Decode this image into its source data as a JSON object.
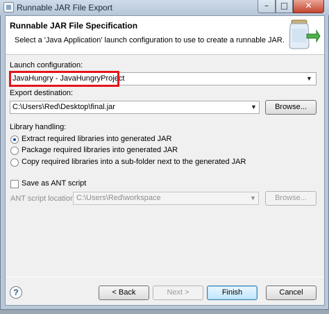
{
  "window": {
    "title": "Runnable JAR File Export",
    "minimize_glyph": "–",
    "maximize_glyph": "□",
    "close_glyph": "✕"
  },
  "header": {
    "title": "Runnable JAR File Specification",
    "description": "Select a 'Java Application' launch configuration to use to create a runnable JAR."
  },
  "launch": {
    "label": "Launch configuration:",
    "value": "JavaHungry - JavaHungryProject",
    "highlight_color": "#e6141b"
  },
  "export": {
    "label": "Export destination:",
    "value": "C:\\Users\\Red\\Desktop\\final.jar",
    "browse_label": "Browse..."
  },
  "library": {
    "label": "Library handling:",
    "options": [
      {
        "label": "Extract required libraries into generated JAR",
        "selected": true
      },
      {
        "label": "Package required libraries into generated JAR",
        "selected": false
      },
      {
        "label": "Copy required libraries into a sub-folder next to the generated JAR",
        "selected": false
      }
    ]
  },
  "ant": {
    "save_label": "Save as ANT script",
    "checked": false,
    "location_label": "ANT script location:",
    "location_value": "C:\\Users\\Red\\workspace",
    "browse_label": "Browse..."
  },
  "footer": {
    "help_glyph": "?",
    "back_label": "< Back",
    "next_label": "Next >",
    "finish_label": "Finish",
    "cancel_label": "Cancel"
  },
  "icons": {
    "app": "app-window-icon",
    "banner": "jar-export-icon",
    "help": "help-icon"
  }
}
